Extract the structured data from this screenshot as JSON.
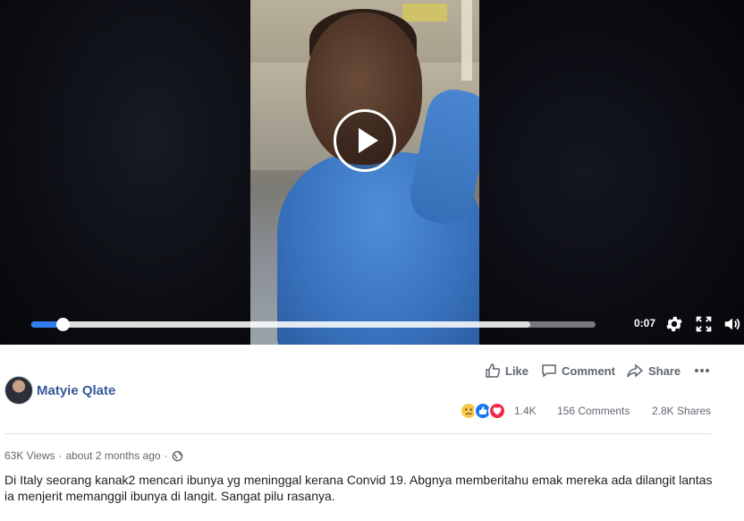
{
  "video": {
    "current_time": "0:07",
    "progress_played": 0.055,
    "progress_buffered": 0.885,
    "controls": {
      "play_icon": "play-icon",
      "settings_icon": "gear-icon",
      "fullscreen_icon": "fullscreen-icon",
      "volume_icon": "volume-icon"
    },
    "accent_color": "#2f7ff0"
  },
  "post": {
    "author": "Matyie Qlate",
    "actions": {
      "like": "Like",
      "comment": "Comment",
      "share": "Share"
    },
    "reactions": {
      "icons": [
        "sad-reaction-icon",
        "like-reaction-icon",
        "love-reaction-icon"
      ],
      "count": "1.4K"
    },
    "comments_count": "156 Comments",
    "shares_count": "2.8K Shares",
    "views": "63K Views",
    "separator": "·",
    "time_ago": "about 2 months ago",
    "privacy_icon": "globe-icon",
    "caption": "Di Italy seorang kanak2 mencari ibunya yg meninggal kerana Convid 19. Abgnya memberitahu emak mereka ada dilangit lantas ia menjerit memanggil ibunya di langit. Sangat pilu rasanya.",
    "link_color": "#385898"
  }
}
